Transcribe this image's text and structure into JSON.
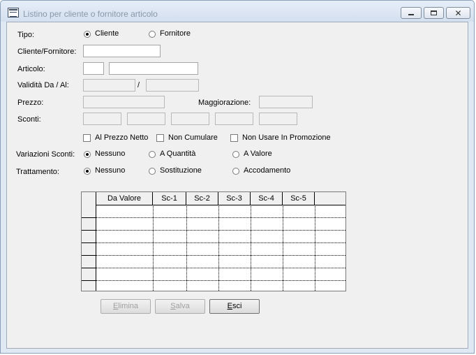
{
  "window": {
    "title": "Listino per cliente o fornitore articolo"
  },
  "form": {
    "tipo_label": "Tipo:",
    "tipo_options": [
      "Cliente",
      "Fornitore"
    ],
    "cliente_label": "Cliente/Fornitore:",
    "articolo_label": "Articolo:",
    "validita_label": "Validità Da / Al:",
    "validita_sep": "/",
    "prezzo_label": "Prezzo:",
    "maggiorazione_label": "Maggiorazione:",
    "sconti_label": "Sconti:",
    "checks": [
      "Al Prezzo Netto",
      "Non Cumulare",
      "Non Usare In Promozione"
    ],
    "variazioni_label": "Variazioni Sconti:",
    "variazioni_options": [
      "Nessuno",
      "A Quantità",
      "A Valore"
    ],
    "trattamento_label": "Trattamento:",
    "trattamento_options": [
      "Nessuno",
      "Sostituzione",
      "Accodamento"
    ]
  },
  "grid": {
    "columns": [
      "Da Valore",
      "Sc-1",
      "Sc-2",
      "Sc-3",
      "Sc-4",
      "Sc-5"
    ]
  },
  "buttons": {
    "elimina": {
      "first": "E",
      "rest": "limina"
    },
    "salva": {
      "first": "S",
      "rest": "alva"
    },
    "esci": {
      "first": "E",
      "rest": "sci"
    }
  }
}
